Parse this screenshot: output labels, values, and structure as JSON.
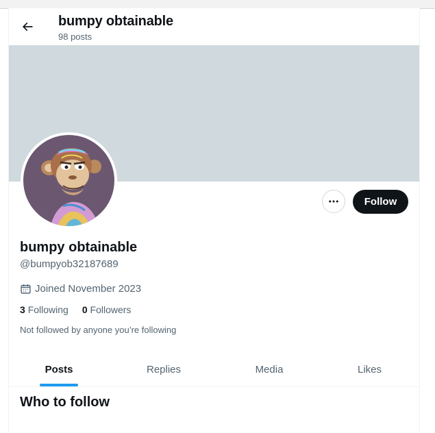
{
  "header": {
    "title": "bumpy obtainable",
    "post_count": "98 posts"
  },
  "profile": {
    "name": "bumpy obtainable",
    "handle": "@bumpyob32187689",
    "joined": "Joined November 2023",
    "following_count": "3",
    "following_label": "Following",
    "followers_count": "0",
    "followers_label": "Followers",
    "not_followed_note": "Not followed by anyone you’re following",
    "follow_button": "Follow",
    "avatar_icon": "ape-avatar-icon"
  },
  "tabs": [
    {
      "label": "Posts",
      "active": true
    },
    {
      "label": "Replies",
      "active": false
    },
    {
      "label": "Media",
      "active": false
    },
    {
      "label": "Likes",
      "active": false
    }
  ],
  "sections": {
    "who_to_follow": "Who to follow"
  },
  "colors": {
    "banner": "#cfd9de",
    "accent": "#1d9bf0",
    "follow_button_bg": "#0f1419",
    "secondary_text": "#536471"
  }
}
